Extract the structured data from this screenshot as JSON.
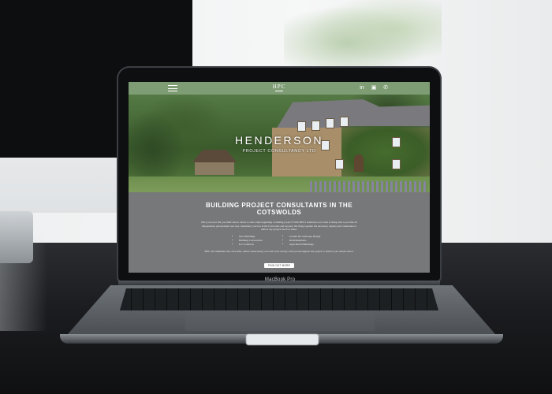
{
  "laptop": {
    "model_label": "MacBook Pro"
  },
  "site": {
    "logo": "HPC",
    "hero_title": "HENDERSON",
    "hero_subtitle": "PROJECT CONSULTANCY LTD",
    "nav_icons": [
      "menu-icon",
      "linkedin-icon",
      "instagram-icon",
      "phone-icon"
    ],
    "accent_color": "#7f9d75",
    "heading": "BUILDING PROJECT CONSULTANTS IN THE COTSWOLDS",
    "intro": "Have you ever felt you didn't know where to start when beginning a building project? With HPC's assistance our value is being able to provide an independent, personalised one stop consultancy service in the Cotswolds and beyond. We bring together the necessary experts and consultants to deliver my projects such as these:",
    "services_left": [
      "New Buildings",
      "Building Conversions",
      "Eco Solutions"
    ],
    "services_right": [
      "Garden & Landscape Design",
      "Refurbishments",
      "Agricultural Buildings"
    ],
    "closing": "HPC will minimise risk, save time, reduce unnecessary cost and work closely with you throughout the project to deliver your dream vision.",
    "cta_label": "FIND OUT MORE"
  }
}
